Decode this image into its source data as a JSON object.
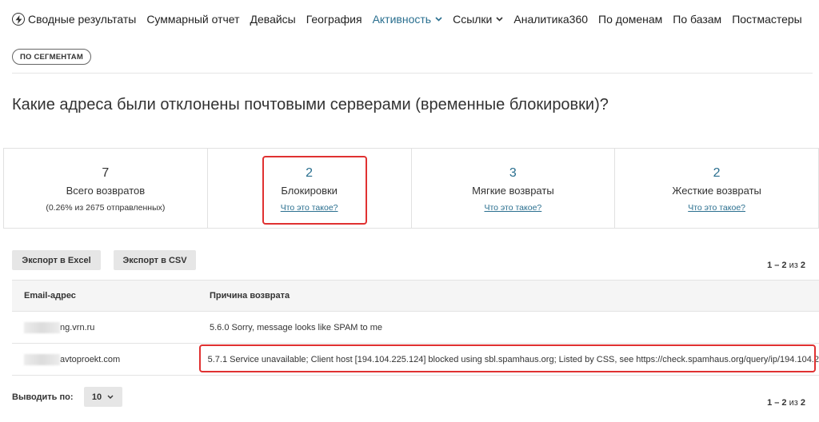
{
  "nav": {
    "items": [
      {
        "label": "Сводные результаты",
        "icon": "lightning-icon"
      },
      {
        "label": "Суммарный отчет"
      },
      {
        "label": "Девайсы"
      },
      {
        "label": "География"
      },
      {
        "label": "Активность",
        "active": true,
        "dropdown": true
      },
      {
        "label": "Ссылки",
        "dropdown": true
      },
      {
        "label": "Аналитика360"
      },
      {
        "label": "По доменам"
      },
      {
        "label": "По базам"
      },
      {
        "label": "Постмастеры"
      }
    ],
    "segment_pill": "ПО СЕГМЕНТАМ"
  },
  "page_title": "Какие адреса были отклонены почтовыми серверами (временные блокировки)?",
  "stats": [
    {
      "value": "7",
      "label": "Всего возвратов",
      "sub": "(0.26% из 2675 отправленных)"
    },
    {
      "value": "2",
      "label": "Блокировки",
      "link": "Что это такое?"
    },
    {
      "value": "3",
      "label": "Мягкие возвраты",
      "link": "Что это такое?"
    },
    {
      "value": "2",
      "label": "Жесткие возвраты",
      "link": "Что это такое?"
    }
  ],
  "toolbar": {
    "export_excel": "Экспорт в Excel",
    "export_csv": "Экспорт в CSV"
  },
  "pagination": {
    "range": "1 – 2",
    "of": "из",
    "total": "2"
  },
  "table": {
    "headers": [
      "Email-адрес",
      "Причина возврата"
    ],
    "rows": [
      {
        "email": "ng.vrn.ru",
        "reason": "5.6.0 Sorry, message looks like SPAM to me"
      },
      {
        "email": "avtoproekt.com",
        "reason": "5.7.1 Service unavailable; Client host [194.104.225.124] blocked using sbl.spamhaus.org; Listed by CSS, see https://check.spamhaus.org/query/ip/194.104.2"
      }
    ]
  },
  "per_page": {
    "label": "Выводить по:",
    "value": "10"
  },
  "colors": {
    "accent": "#2a6f8f",
    "highlight": "#e03131",
    "button_bg": "#e6e6e6",
    "header_bg": "#f5f5f5"
  }
}
